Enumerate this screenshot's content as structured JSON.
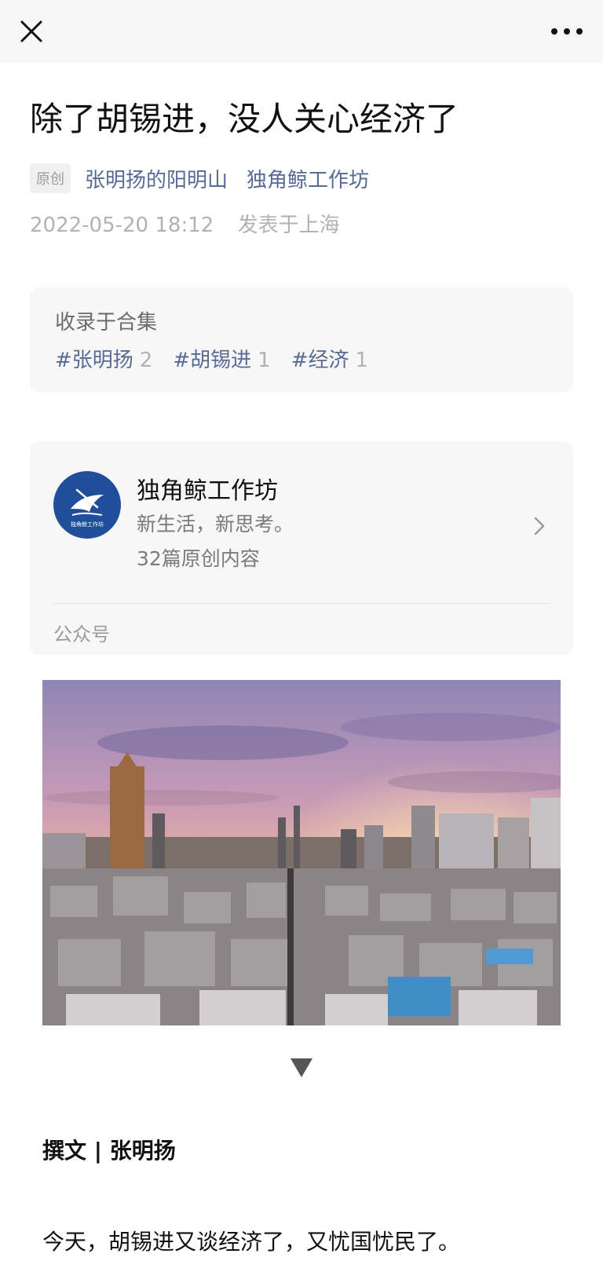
{
  "topbar": {
    "close_icon": "close-icon",
    "more_icon": "more-dots-icon"
  },
  "article": {
    "title": "除了胡锡进，没人关心经济了",
    "original_tag": "原创",
    "author": "张明扬的阳明山",
    "account": "独角鲸工作坊",
    "date": "2022-05-20 18:12",
    "location": "发表于上海"
  },
  "collection": {
    "label": "收录于合集",
    "tags": [
      {
        "name": "#张明扬",
        "count": "2"
      },
      {
        "name": "#胡锡进",
        "count": "1"
      },
      {
        "name": "#经济",
        "count": "1"
      }
    ]
  },
  "profile_card": {
    "name": "独角鲸工作坊",
    "desc": "新生活，新思考。",
    "count": "32篇原创内容",
    "type": "公众号",
    "logo_text": "独角鲸工作坊",
    "chevron_icon": "chevron-right-icon"
  },
  "body": {
    "byline": "撰文 | 张明扬",
    "para1": "今天，胡锡进又谈经济了，又忧国忧民了。"
  },
  "colors": {
    "link": "#576b95",
    "avatar_bg": "#1f4f9a"
  }
}
